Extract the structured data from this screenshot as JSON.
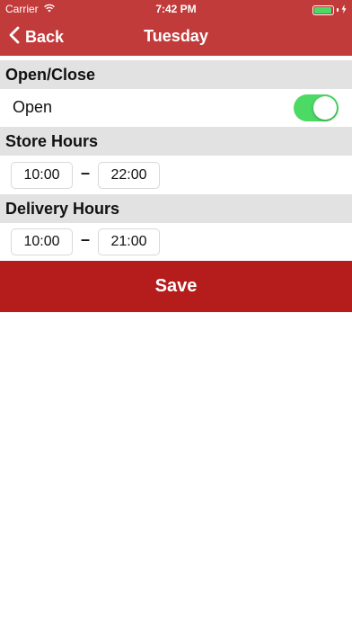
{
  "status_bar": {
    "carrier": "Carrier",
    "time": "7:42 PM",
    "battery_level": 0.95,
    "icons": [
      "wifi-icon",
      "battery-icon",
      "charging-icon"
    ]
  },
  "nav": {
    "back_label": "Back",
    "title": "Tuesday",
    "back_icon": "chevron-left-icon"
  },
  "open_close": {
    "header": "Open/Close",
    "label": "Open",
    "enabled": true
  },
  "store_hours": {
    "header": "Store Hours",
    "start": "10:00",
    "separator": "–",
    "end": "22:00"
  },
  "delivery_hours": {
    "header": "Delivery Hours",
    "start": "10:00",
    "separator": "–",
    "end": "21:00"
  },
  "save_label": "Save",
  "colors": {
    "brand_red": "#c23b3b",
    "save_red": "#b51c1c",
    "toggle_green": "#4cd964",
    "section_gray": "#e2e2e2"
  }
}
